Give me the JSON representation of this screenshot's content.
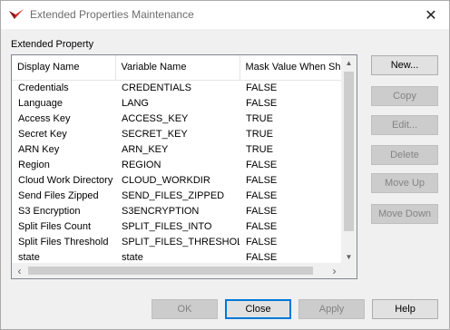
{
  "window": {
    "title": "Extended Properties Maintenance",
    "close_glyph": "✕"
  },
  "group_label": "Extended Property",
  "table": {
    "columns": [
      "Display Name",
      "Variable Name",
      "Mask Value When Shown"
    ],
    "rows": [
      [
        "Credentials",
        "CREDENTIALS",
        "FALSE"
      ],
      [
        "Language",
        "LANG",
        "FALSE"
      ],
      [
        "Access Key",
        "ACCESS_KEY",
        "TRUE"
      ],
      [
        "Secret Key",
        "SECRET_KEY",
        "TRUE"
      ],
      [
        "ARN Key",
        "ARN_KEY",
        "TRUE"
      ],
      [
        "Region",
        "REGION",
        "FALSE"
      ],
      [
        "Cloud Work Directory",
        "CLOUD_WORKDIR",
        "FALSE"
      ],
      [
        "Send Files Zipped",
        "SEND_FILES_ZIPPED",
        "FALSE"
      ],
      [
        "S3 Encryption",
        "S3ENCRYPTION",
        "FALSE"
      ],
      [
        "Split Files Count",
        "SPLIT_FILES_INTO",
        "FALSE"
      ],
      [
        "Split Files Threshold",
        "SPLIT_FILES_THRESHOLD",
        "FALSE"
      ],
      [
        "state",
        "state",
        "FALSE"
      ]
    ]
  },
  "side_buttons": {
    "new": "New...",
    "copy": "Copy",
    "edit": "Edit...",
    "delete": "Delete",
    "move_up": "Move Up",
    "move_down": "Move Down"
  },
  "bottom_buttons": {
    "ok": "OK",
    "close": "Close",
    "apply": "Apply",
    "help": "Help"
  },
  "colors": {
    "accent": "#0078d7",
    "icon_red": "#d32f2f"
  }
}
